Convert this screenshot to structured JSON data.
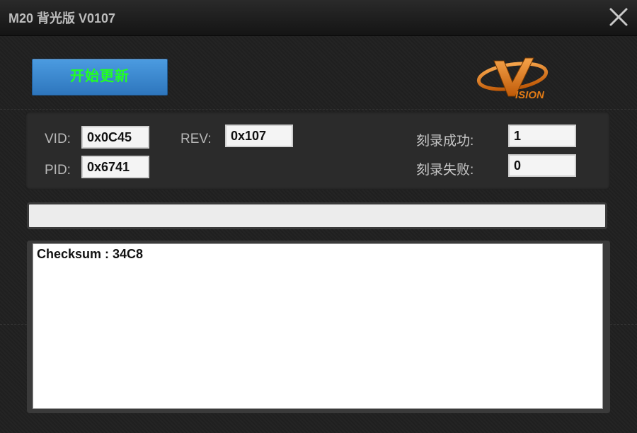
{
  "window": {
    "title": "M20 背光版 V0107",
    "close_icon": "close-x-icon"
  },
  "toolbar": {
    "start_update_label": "开始更新"
  },
  "logo": {
    "icon": "vision-logo",
    "text": "ISION",
    "accent_color": "#e07a16"
  },
  "device": {
    "vid_label": "VID:",
    "vid_value": "0x0C45",
    "pid_label": "PID:",
    "pid_value": "0x6741",
    "rev_label": "REV:",
    "rev_value": "0x107"
  },
  "stats": {
    "success_label": "刻录成功:",
    "success_value": "1",
    "fail_label": "刻录失败:",
    "fail_value": "0"
  },
  "progress": {
    "fraction": 0
  },
  "log": {
    "text": "Checksum : 34C8"
  },
  "colors": {
    "button_bg": "#3a88d0",
    "button_text": "#22ff22",
    "background": "#202020"
  }
}
